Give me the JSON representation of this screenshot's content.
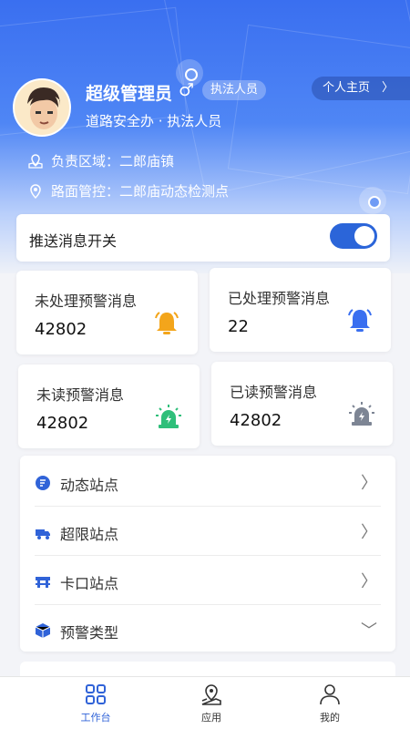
{
  "profile": {
    "name": "超级管理员",
    "gender_symbol": "♂",
    "role_badge": "执法人员",
    "homepage_label": "个人主页",
    "homepage_chevron": "〉",
    "subtitle": "道路安全办 · 执法人员",
    "area_label": "负责区域：二郎庙镇",
    "road_label": "路面管控：二郎庙动态检测点"
  },
  "push_switch": {
    "label": "推送消息开关",
    "on": true
  },
  "stats": [
    {
      "title": "未处理预警消息",
      "value": "42802",
      "icon": "bell-icon",
      "color": "#f3a51b"
    },
    {
      "title": "已处理预警消息",
      "value": "22",
      "icon": "bell-icon",
      "color": "#3a6ff0"
    },
    {
      "title": "未读预警消息",
      "value": "42802",
      "icon": "alarm-light-icon",
      "color": "#2fbf7a"
    },
    {
      "title": "已读预警消息",
      "value": "42802",
      "icon": "alarm-light-icon",
      "color": "#7d8594"
    }
  ],
  "menu": [
    {
      "label": "动态站点",
      "icon": "dynamic-station-icon",
      "arrow": "〉"
    },
    {
      "label": "超限站点",
      "icon": "truck-icon",
      "arrow": "〉"
    },
    {
      "label": "卡口站点",
      "icon": "checkpoint-icon",
      "arrow": "〉"
    },
    {
      "label": "预警类型",
      "icon": "cube-icon",
      "arrow": "﹀"
    }
  ],
  "tabs": [
    {
      "label": "工作台",
      "icon": "grid-icon",
      "active": true
    },
    {
      "label": "应用",
      "icon": "map-pin-icon",
      "active": false
    },
    {
      "label": "我的",
      "icon": "user-icon",
      "active": false
    }
  ],
  "colors": {
    "primary": "#3063d8",
    "hero_top": "#3a6ff0"
  }
}
